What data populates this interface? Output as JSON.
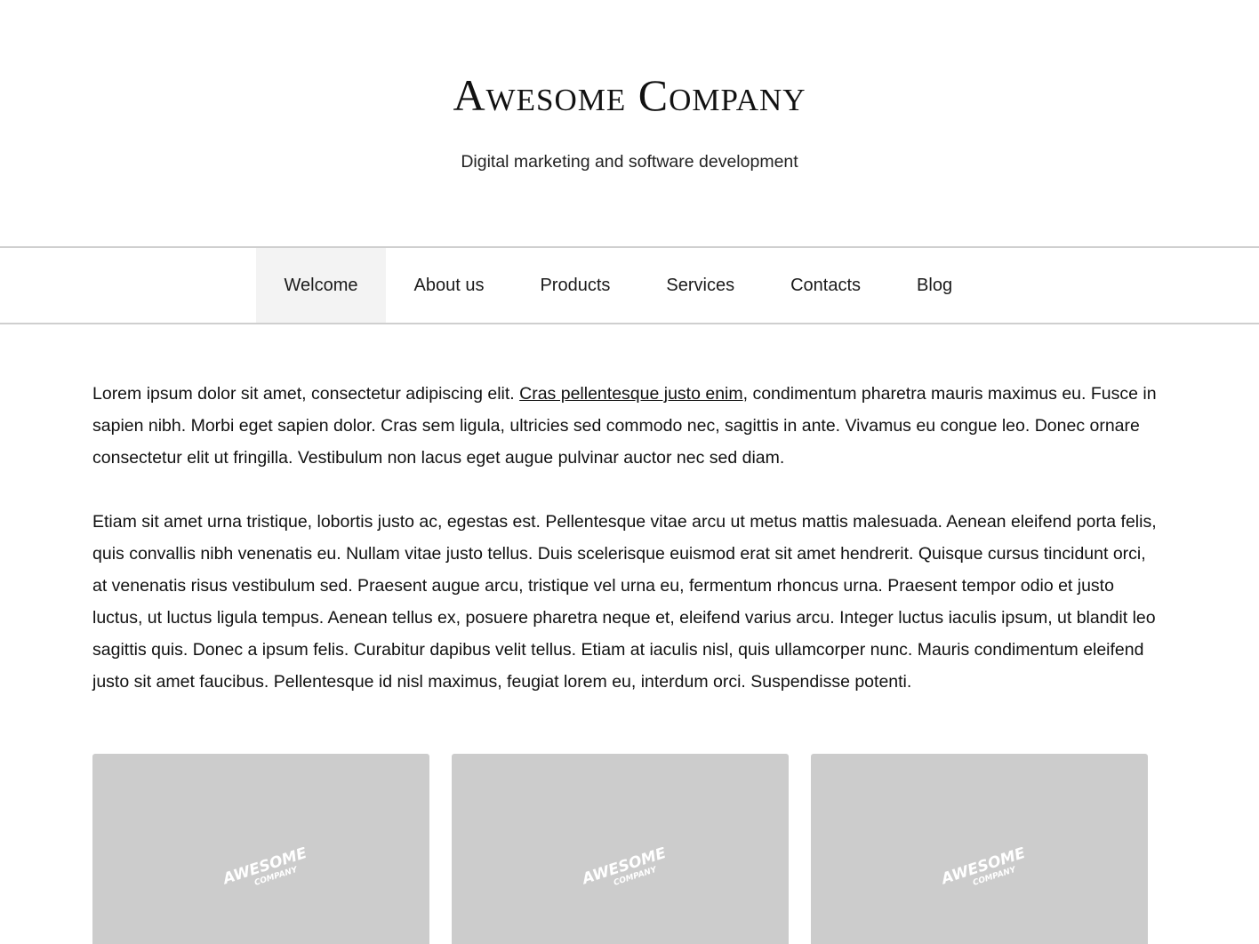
{
  "header": {
    "title": "Awesome Company",
    "tagline": "Digital marketing and software development"
  },
  "nav": {
    "items": [
      {
        "label": "Welcome",
        "active": true
      },
      {
        "label": "About us"
      },
      {
        "label": "Products"
      },
      {
        "label": "Services"
      },
      {
        "label": "Contacts"
      },
      {
        "label": "Blog"
      }
    ]
  },
  "content": {
    "p1_before": "Lorem ipsum dolor sit amet, consectetur adipiscing elit. ",
    "p1_link": "Cras pellentesque justo enim",
    "p1_after": ", condimentum pharetra mauris maximus eu. Fusce in sapien nibh. Morbi eget sapien dolor. Cras sem ligula, ultricies sed commodo nec, sagittis in ante. Vivamus eu congue leo. Donec ornare consectetur elit ut fringilla. Vestibulum non lacus eget augue pulvinar auctor nec sed diam.",
    "p2": "Etiam sit amet urna tristique, lobortis justo ac, egestas est. Pellentesque vitae arcu ut metus mattis malesuada. Aenean eleifend porta felis, quis convallis nibh venenatis eu. Nullam vitae justo tellus. Duis scelerisque euismod erat sit amet hendrerit. Quisque cursus tincidunt orci, at venenatis risus vestibulum sed. Praesent augue arcu, tristique vel urna eu, fermentum rhoncus urna. Praesent tempor odio et justo luctus, ut luctus ligula tempus. Aenean tellus ex, posuere pharetra neque et, eleifend varius arcu. Integer luctus iaculis ipsum, ut blandit leo sagittis quis. Donec a ipsum felis. Curabitur dapibus velit tellus. Etiam at iaculis nisl, quis ullamcorper nunc. Mauris condimentum eleifend justo sit amet faucibus. Pellentesque id nisl maximus, feugiat lorem eu, interdum orci. Suspendisse potenti."
  },
  "cards": {
    "logo_line1": "AWESOME",
    "logo_line2": "COMPANY",
    "colors": {
      "placeholder_bg": "#cccccc",
      "logo": "#ffffff"
    }
  }
}
